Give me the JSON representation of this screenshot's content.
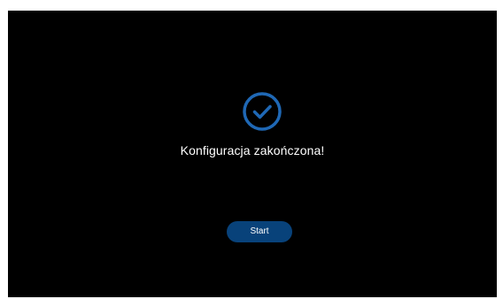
{
  "setup_complete": {
    "message": "Konfiguracja zakończona!",
    "start_label": "Start"
  },
  "colors": {
    "background": "#000000",
    "accent": "#1f68b5",
    "button": "#08427a",
    "text": "#ffffff"
  },
  "icons": {
    "status": "check-circle-icon"
  }
}
